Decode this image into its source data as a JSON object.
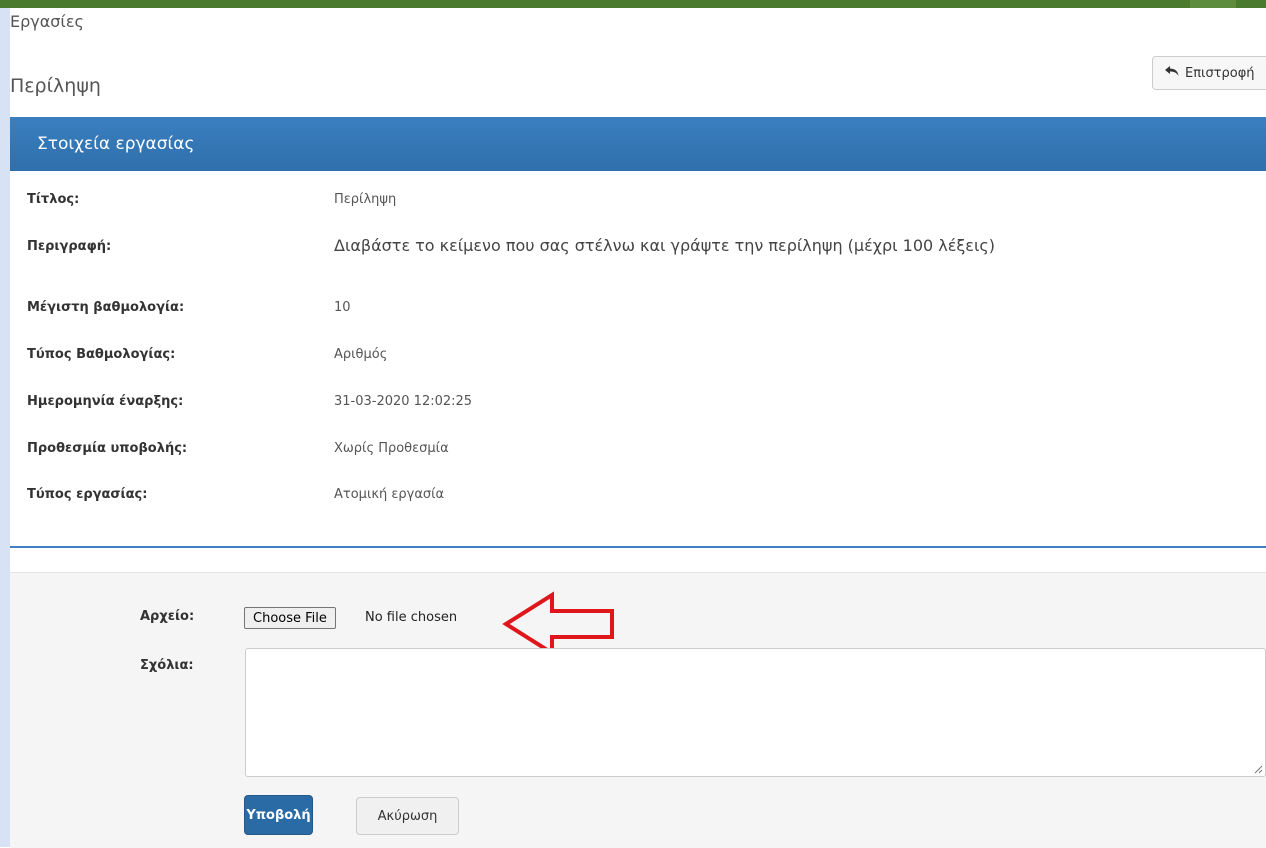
{
  "breadcrumb": "Εργασίες",
  "page_title": "Περίληψη",
  "back_button": {
    "label": "Επιστροφή",
    "icon": "reply-icon"
  },
  "panel": {
    "heading": "Στοιχεία εργασίας",
    "fields": [
      {
        "label": "Τίτλος:",
        "value": "Περίληψη"
      },
      {
        "label": "Περιγραφή:",
        "value": "Διαβάστε το κείμενο που σας στέλνω και γράψτε την περίληψη (μέχρι 100 λέξεις)"
      },
      {
        "label": "Μέγιστη βαθμολογία:",
        "value": "10"
      },
      {
        "label": "Τύπος Βαθμολογίας:",
        "value": "Αριθμός"
      },
      {
        "label": "Ημερομηνία έναρξης:",
        "value": "31-03-2020 12:02:25"
      },
      {
        "label": "Προθεσμία υποβολής:",
        "value": "Χωρίς Προθεσμία"
      },
      {
        "label": "Τύπος εργασίας:",
        "value": "Ατομική εργασία"
      }
    ]
  },
  "form": {
    "file_label": "Αρχείο:",
    "choose_file": "Choose File",
    "file_status": "No file chosen",
    "comments_label": "Σχόλια:",
    "comments_value": "",
    "submit": "Υποβολή",
    "cancel": "Ακύρωση"
  },
  "colors": {
    "top_bar": "#4a7a2e",
    "panel_heading": "#2f6fab",
    "submit_button": "#2a6ba6",
    "annotation_arrow": "#e0161b"
  }
}
